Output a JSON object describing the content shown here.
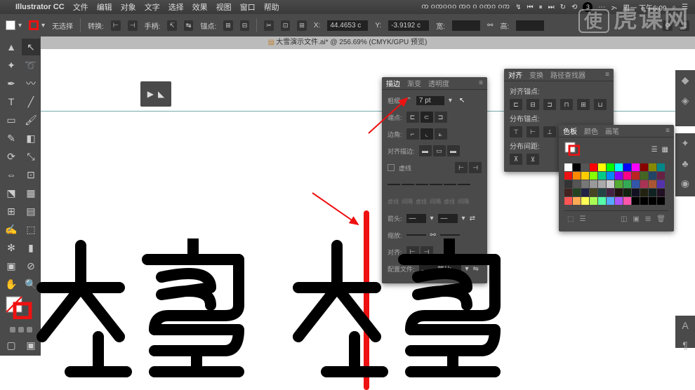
{
  "menubar": {
    "apple": "",
    "app": "Illustrator CC",
    "items": [
      "文件",
      "编辑",
      "对象",
      "文字",
      "选择",
      "效果",
      "视图",
      "窗口",
      "帮助"
    ],
    "right": [
      "ᨠ ᨣᨠᨣᨣᨣ ᨠᨣ ᨣ ᨣᨠᨣ ᨣᨠ",
      "↯",
      "⏮",
      "⏸",
      "⏭",
      "↻",
      "⟲",
      "3",
      "⋯",
      "ᯢ",
      "周一 下午6:09",
      "⌕",
      "☰"
    ]
  },
  "controlbar": {
    "noSelection": "无选择",
    "convert": "转换:",
    "handle": "手柄:",
    "anchor": "锚点:",
    "xLabel": "X:",
    "xValue": "44.4653 c",
    "yLabel": "Y:",
    "yValue": "-3.9192 c",
    "wLabel": "宽:",
    "hLabel": "高:"
  },
  "document": {
    "title": "大雪演示文件.ai* @ 256.69% (CMYK/GPU 预览)"
  },
  "stroke": {
    "tabs": [
      "描边",
      "渐变",
      "透明度"
    ],
    "weightLabel": "粗细:",
    "weight": "7 pt",
    "capLabel": "端点:",
    "cornerLabel": "边角:",
    "alignLabel": "对齐描边:",
    "dashedLabel": "虚线",
    "dashHeaders": [
      "虚线",
      "间隔",
      "虚线",
      "间隔",
      "虚线",
      "间隔"
    ],
    "arrowLabel": "箭头:",
    "scaleLabel": "缩放:",
    "alignArrowLabel": "对齐:",
    "profileLabel": "配置文件:",
    "profileValue": "—— 等比"
  },
  "align": {
    "tabs": [
      "对齐",
      "变换",
      "路径查找器"
    ],
    "section1": "对齐锚点:",
    "section2": "分布锚点:",
    "section3": "分布间距:"
  },
  "swatches": {
    "tabs": [
      "色板",
      "颜色",
      "画笔"
    ],
    "colors": [
      "#fff",
      "#000",
      "#555",
      "#f00",
      "#ff0",
      "#0f0",
      "#0ff",
      "#00f",
      "#f0f",
      "#800",
      "#880",
      "#088",
      "#e11",
      "#f80",
      "#fc0",
      "#8f0",
      "#0c8",
      "#08f",
      "#80f",
      "#f08",
      "#b22",
      "#462",
      "#246",
      "#624",
      "#333",
      "#555",
      "#777",
      "#999",
      "#aaa",
      "#ccc",
      "#5a3",
      "#3a5",
      "#35a",
      "#a35",
      "#a53",
      "#53a",
      "#422",
      "#242",
      "#224",
      "#442",
      "#244",
      "#424",
      "#211",
      "#121",
      "#112",
      "#221",
      "#122",
      "#212",
      "#f55",
      "#fa5",
      "#ff5",
      "#af5",
      "#5fa",
      "#5af",
      "#a5f",
      "#f5a",
      "#000",
      "#000",
      "#000",
      "#000"
    ]
  },
  "watermark": "虎课网"
}
